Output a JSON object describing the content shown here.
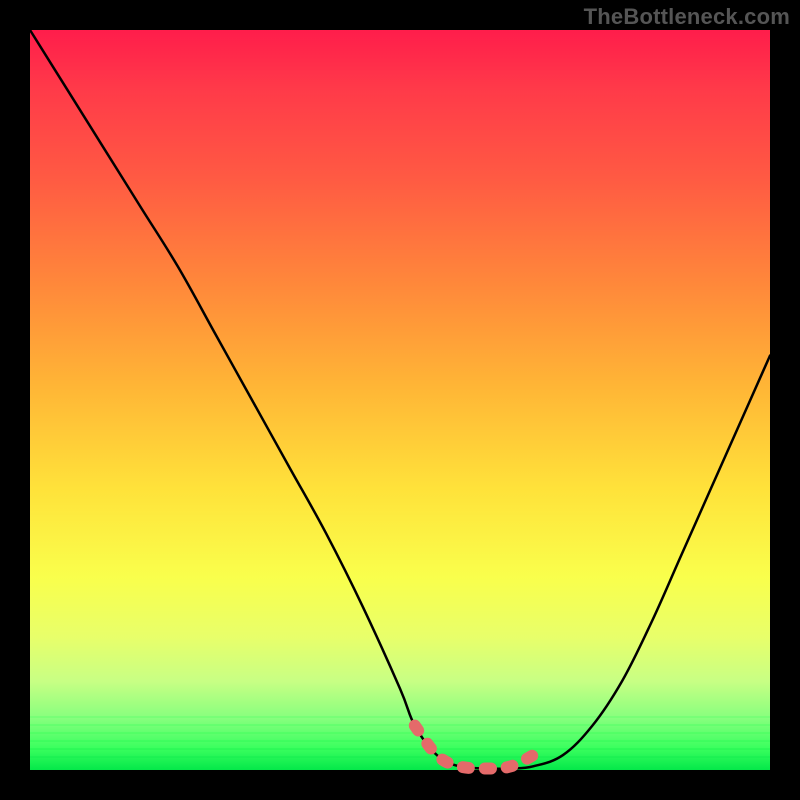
{
  "watermark": {
    "text": "TheBottleneck.com"
  },
  "colors": {
    "black": "#000000",
    "curve": "#000000",
    "highlight": "#e46a6a",
    "watermark": "#555555"
  },
  "chart_data": {
    "type": "line",
    "title": "",
    "xlabel": "",
    "ylabel": "",
    "xlim": [
      0,
      100
    ],
    "ylim": [
      0,
      100
    ],
    "grid": false,
    "legend": false,
    "annotations": [
      "TheBottleneck.com"
    ],
    "series": [
      {
        "name": "bottleneck-curve",
        "x": [
          0,
          5,
          10,
          15,
          20,
          25,
          30,
          35,
          40,
          45,
          50,
          52,
          55,
          58,
          62,
          65,
          68,
          72,
          76,
          80,
          84,
          88,
          92,
          96,
          100
        ],
        "y": [
          100,
          92,
          84,
          76,
          68,
          59,
          50,
          41,
          32,
          22,
          11,
          6,
          2,
          0.5,
          0.2,
          0.2,
          0.5,
          2,
          6,
          12,
          20,
          29,
          38,
          47,
          56
        ]
      },
      {
        "name": "optimal-range-highlight",
        "x": [
          52,
          55,
          58,
          62,
          65,
          68
        ],
        "y": [
          6,
          2,
          0.5,
          0.2,
          0.5,
          2
        ]
      }
    ],
    "notes": "V-shaped bottleneck curve over a vertical red-to-green gradient. The flat valley around x 55-68 is highlighted with a light-red dashed overlay. No axis tick labels are visible."
  }
}
